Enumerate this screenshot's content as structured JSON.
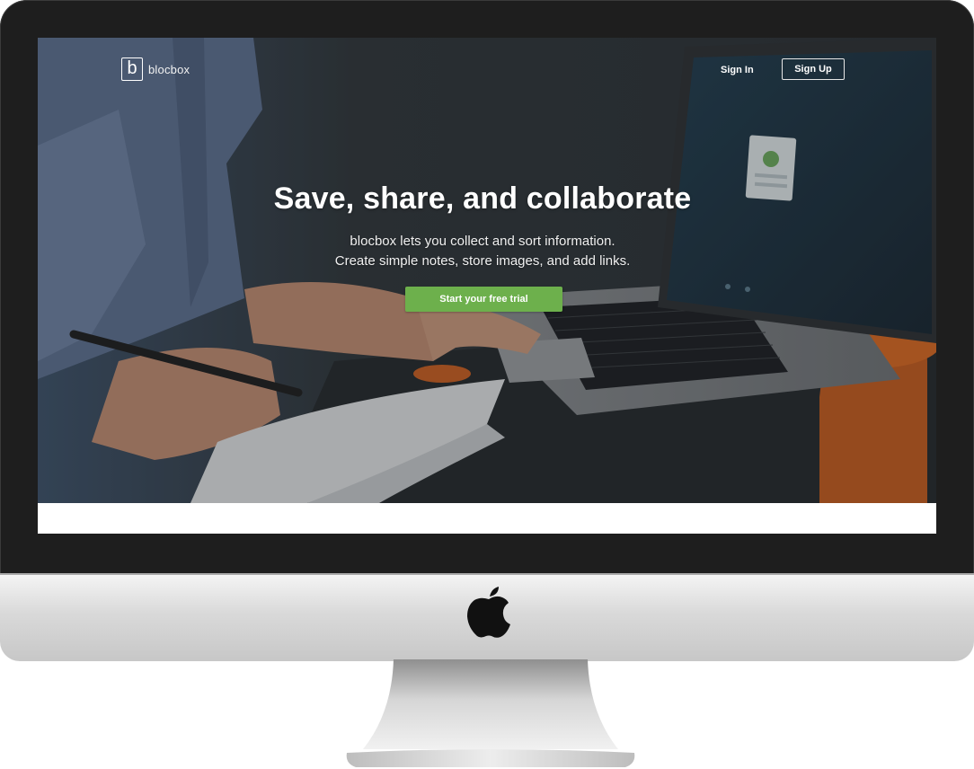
{
  "nav": {
    "brand_letter": "b",
    "brand_name": "blocbox",
    "signin_label": "Sign In",
    "signup_label": "Sign Up"
  },
  "hero": {
    "headline": "Save, share, and collaborate",
    "subline_1": "blocbox lets you collect and sort information.",
    "subline_2": "Create simple notes, store images, and add links.",
    "cta_label": "Start your free trial"
  },
  "device": {
    "logo_icon": "apple-logo-icon"
  },
  "colors": {
    "cta": "#6db04c",
    "hero_overlay": "#1c2024",
    "bezel": "#1e1e1e",
    "chin": "#d9d9d9",
    "accent_orange": "#e0671f"
  }
}
